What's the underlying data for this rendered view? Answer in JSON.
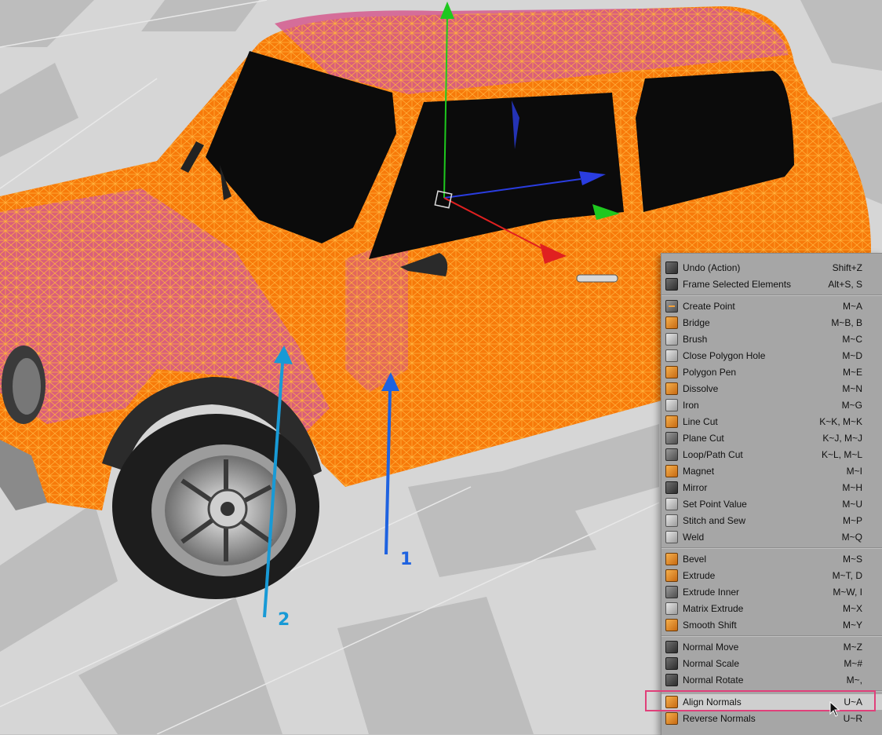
{
  "viewport": {
    "callouts": [
      {
        "id": "1",
        "label": "1",
        "color": "#1e62e0"
      },
      {
        "id": "2",
        "label": "2",
        "color": "#189ad6"
      }
    ]
  },
  "colors": {
    "mesh_orange": "#f77a0a",
    "mesh_pink": "#d55b8e",
    "wire": "#ffb23d",
    "glass": "#0b0b0b",
    "tire": "#1d1d1d",
    "floor_light": "#d9d9d9",
    "floor_dark": "#c2c2c2",
    "menu_bg": "#a6a6a6",
    "highlight_frame": "#e0407a",
    "axis_x": "#e02020",
    "axis_y": "#1ec81e",
    "axis_z": "#2a3de0"
  },
  "context_menu": {
    "groups": [
      [
        {
          "label": "Undo (Action)",
          "shortcut": "Shift+Z",
          "icon": "undo-icon"
        },
        {
          "label": "Frame Selected Elements",
          "shortcut": "Alt+S, S",
          "icon": "frame-selected-icon"
        }
      ],
      [
        {
          "label": "Create Point",
          "shortcut": "M~A",
          "icon": "create-point-icon"
        },
        {
          "label": "Bridge",
          "shortcut": "M~B, B",
          "icon": "bridge-icon"
        },
        {
          "label": "Brush",
          "shortcut": "M~C",
          "icon": "brush-icon"
        },
        {
          "label": "Close Polygon Hole",
          "shortcut": "M~D",
          "icon": "close-polygon-hole-icon"
        },
        {
          "label": "Polygon Pen",
          "shortcut": "M~E",
          "icon": "polygon-pen-icon"
        },
        {
          "label": "Dissolve",
          "shortcut": "M~N",
          "icon": "dissolve-icon"
        },
        {
          "label": "Iron",
          "shortcut": "M~G",
          "icon": "iron-icon"
        },
        {
          "label": "Line Cut",
          "shortcut": "K~K, M~K",
          "icon": "line-cut-icon"
        },
        {
          "label": "Plane Cut",
          "shortcut": "K~J, M~J",
          "icon": "plane-cut-icon"
        },
        {
          "label": "Loop/Path Cut",
          "shortcut": "K~L, M~L",
          "icon": "loop-path-cut-icon"
        },
        {
          "label": "Magnet",
          "shortcut": "M~I",
          "icon": "magnet-icon"
        },
        {
          "label": "Mirror",
          "shortcut": "M~H",
          "icon": "mirror-icon"
        },
        {
          "label": "Set Point Value",
          "shortcut": "M~U",
          "icon": "set-point-value-icon"
        },
        {
          "label": "Stitch and Sew",
          "shortcut": "M~P",
          "icon": "stitch-and-sew-icon"
        },
        {
          "label": "Weld",
          "shortcut": "M~Q",
          "icon": "weld-icon"
        }
      ],
      [
        {
          "label": "Bevel",
          "shortcut": "M~S",
          "icon": "bevel-icon"
        },
        {
          "label": "Extrude",
          "shortcut": "M~T, D",
          "icon": "extrude-icon"
        },
        {
          "label": "Extrude Inner",
          "shortcut": "M~W, I",
          "icon": "extrude-inner-icon"
        },
        {
          "label": "Matrix Extrude",
          "shortcut": "M~X",
          "icon": "matrix-extrude-icon"
        },
        {
          "label": "Smooth Shift",
          "shortcut": "M~Y",
          "icon": "smooth-shift-icon"
        }
      ],
      [
        {
          "label": "Normal Move",
          "shortcut": "M~Z",
          "icon": "normal-move-icon"
        },
        {
          "label": "Normal Scale",
          "shortcut": "M~#",
          "icon": "normal-scale-icon"
        },
        {
          "label": "Normal Rotate",
          "shortcut": "M~,",
          "icon": "normal-rotate-icon"
        }
      ],
      [
        {
          "label": "Align Normals",
          "shortcut": "U~A",
          "icon": "align-normals-icon",
          "highlighted": true
        },
        {
          "label": "Reverse Normals",
          "shortcut": "U~R",
          "icon": "reverse-normals-icon"
        }
      ]
    ]
  }
}
